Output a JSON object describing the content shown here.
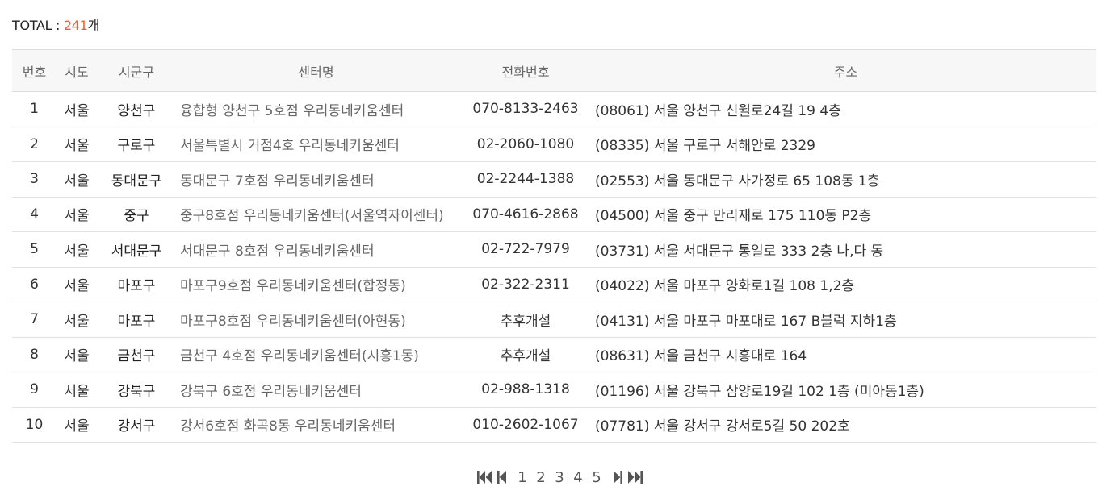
{
  "summary": {
    "label": "TOTAL : ",
    "count": "241",
    "unit": "개"
  },
  "table": {
    "headers": {
      "no": "번호",
      "sido": "시도",
      "sigungu": "시군구",
      "name": "센터명",
      "phone": "전화번호",
      "address": "주소"
    },
    "rows": [
      {
        "no": "1",
        "sido": "서울",
        "sigungu": "양천구",
        "name": "융합형 양천구 5호점 우리동네키움센터",
        "phone": "070-8133-2463",
        "address": "(08061) 서울 양천구 신월로24길 19 4층"
      },
      {
        "no": "2",
        "sido": "서울",
        "sigungu": "구로구",
        "name": "서울특별시 거점4호 우리동네키움센터",
        "phone": "02-2060-1080",
        "address": "(08335) 서울 구로구 서해안로 2329"
      },
      {
        "no": "3",
        "sido": "서울",
        "sigungu": "동대문구",
        "name": "동대문구 7호점 우리동네키움센터",
        "phone": "02-2244-1388",
        "address": "(02553) 서울 동대문구 사가정로 65 108동 1층"
      },
      {
        "no": "4",
        "sido": "서울",
        "sigungu": "중구",
        "name": "중구8호점 우리동네키움센터(서울역자이센터)",
        "phone": "070-4616-2868",
        "address": "(04500) 서울 중구 만리재로 175 110동 P2층"
      },
      {
        "no": "5",
        "sido": "서울",
        "sigungu": "서대문구",
        "name": "서대문구 8호점 우리동네키움센터",
        "phone": "02-722-7979",
        "address": "(03731) 서울 서대문구 통일로 333 2층 나,다 동"
      },
      {
        "no": "6",
        "sido": "서울",
        "sigungu": "마포구",
        "name": "마포구9호점 우리동네키움센터(합정동)",
        "phone": "02-322-2311",
        "address": "(04022) 서울 마포구 양화로1길 108 1,2층"
      },
      {
        "no": "7",
        "sido": "서울",
        "sigungu": "마포구",
        "name": "마포구8호점 우리동네키움센터(아현동)",
        "phone": "추후개설",
        "address": "(04131) 서울 마포구 마포대로 167 B블럭 지하1층"
      },
      {
        "no": "8",
        "sido": "서울",
        "sigungu": "금천구",
        "name": "금천구 4호점 우리동네키움센터(시흥1동)",
        "phone": "추후개설",
        "address": "(08631) 서울 금천구 시흥대로 164"
      },
      {
        "no": "9",
        "sido": "서울",
        "sigungu": "강북구",
        "name": "강북구 6호점 우리동네키움센터",
        "phone": "02-988-1318",
        "address": "(01196) 서울 강북구 삼양로19길 102 1층 (미아동1층)"
      },
      {
        "no": "10",
        "sido": "서울",
        "sigungu": "강서구",
        "name": "강서6호점 화곡8동 우리동네키움센터",
        "phone": "010-2602-1067",
        "address": "(07781) 서울 강서구 강서로5길 50 202호"
      }
    ]
  },
  "pagination": {
    "icons": {
      "first": "first-page-icon",
      "prev": "prev-page-icon",
      "next": "next-page-icon",
      "last": "last-page-icon"
    },
    "pages": [
      "1",
      "2",
      "3",
      "4",
      "5"
    ],
    "current_page": "1"
  },
  "colors": {
    "accent": "#e8622c",
    "header_bg": "#f7f7f7",
    "border": "#dcdcdc"
  }
}
